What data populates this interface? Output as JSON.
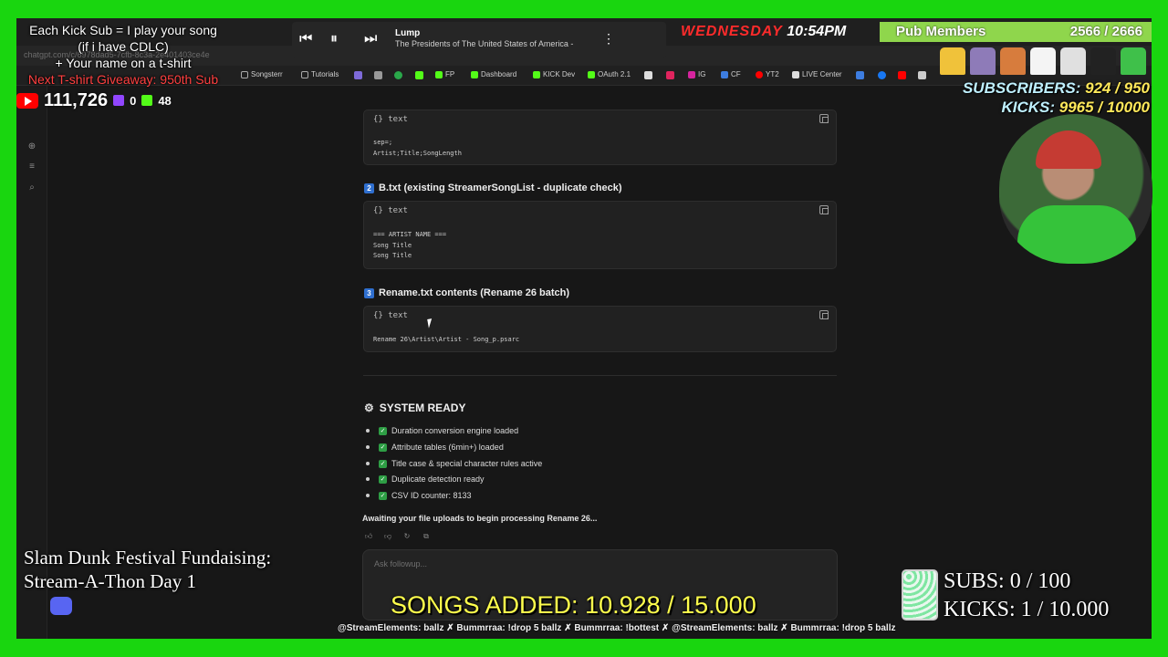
{
  "browser": {
    "url": "chatgpt.com/c/6978dad5-7cfb-8c3a-2e401403ce4e",
    "bookmarks": [
      "Songsterr",
      "Tutorials",
      "FP",
      "Dashboard",
      "KICK Dev",
      "OAuth 2.1",
      "IG",
      "CF",
      "YT2",
      "LIVE Center"
    ]
  },
  "chat": {
    "block1": {
      "lang": "text",
      "code": "sep=;\nArtist;Title;SongLength"
    },
    "section2": {
      "number": "2",
      "title": "B.txt (existing StreamerSongList - duplicate check)"
    },
    "block2": {
      "lang": "text",
      "code": "=== ARTIST NAME ===\nSong Title\nSong Title"
    },
    "section3": {
      "number": "3",
      "title": "Rename.txt contents (Rename 26 batch)"
    },
    "block3": {
      "lang": "text",
      "code": "Rename 26\\Artist\\Artist - Song_p.psarc"
    },
    "ready_title": "SYSTEM READY",
    "checklist": [
      "Duration conversion engine loaded",
      "Attribute tables (6min+) loaded",
      "Title case & special character rules active",
      "Duplicate detection ready",
      "CSV ID counter: 8133"
    ],
    "awaiting": "Awaiting your file uploads to begin processing Rename 26...",
    "followup_placeholder": "Ask followup..."
  },
  "overlay": {
    "kick_sub": [
      "Each Kick Sub = I play your song",
      "(if i have CDLC)",
      "+ Your name on a t-shirt",
      "Next T-shirt Giveaway: 950th Sub"
    ],
    "youtube_count": "111,726",
    "twitch_count": "0",
    "kick_count": "48",
    "now_playing": {
      "title": "Lump",
      "artist": "The Presidents of The United States of America -"
    },
    "clock": {
      "day": "WEDNESDAY",
      "time": "10:54PM"
    },
    "pub_members": {
      "label": "Pub Members",
      "count": "2566 / 2666"
    },
    "goals": {
      "subs_label": "SUBSCRIBERS:",
      "subs_value": "924 / 950",
      "kicks_label": "KICKS:",
      "kicks_value": "9965 / 10000"
    },
    "fundraiser": [
      "Slam Dunk Festival Fundaising:",
      "Stream-A-Thon Day 1"
    ],
    "songs_added": "SONGS ADDED: 10.928 / 15.000",
    "subs_goal": "SUBS:  0 / 100",
    "kicks_goal": "KICKS: 1 / 10.000",
    "ticker": "@StreamElements: ballz  ✗  Bummrraa: !drop 5 ballz  ✗  Bummrraa: !bottest  ✗  @StreamElements: ballz  ✗  Bummrraa: !drop 5 ballz"
  },
  "colors": {
    "screen_green": "#19d60f",
    "accent_red": "#ff2b2b",
    "goal_yellow": "#ffe85a",
    "check_green": "#2e9e45"
  }
}
